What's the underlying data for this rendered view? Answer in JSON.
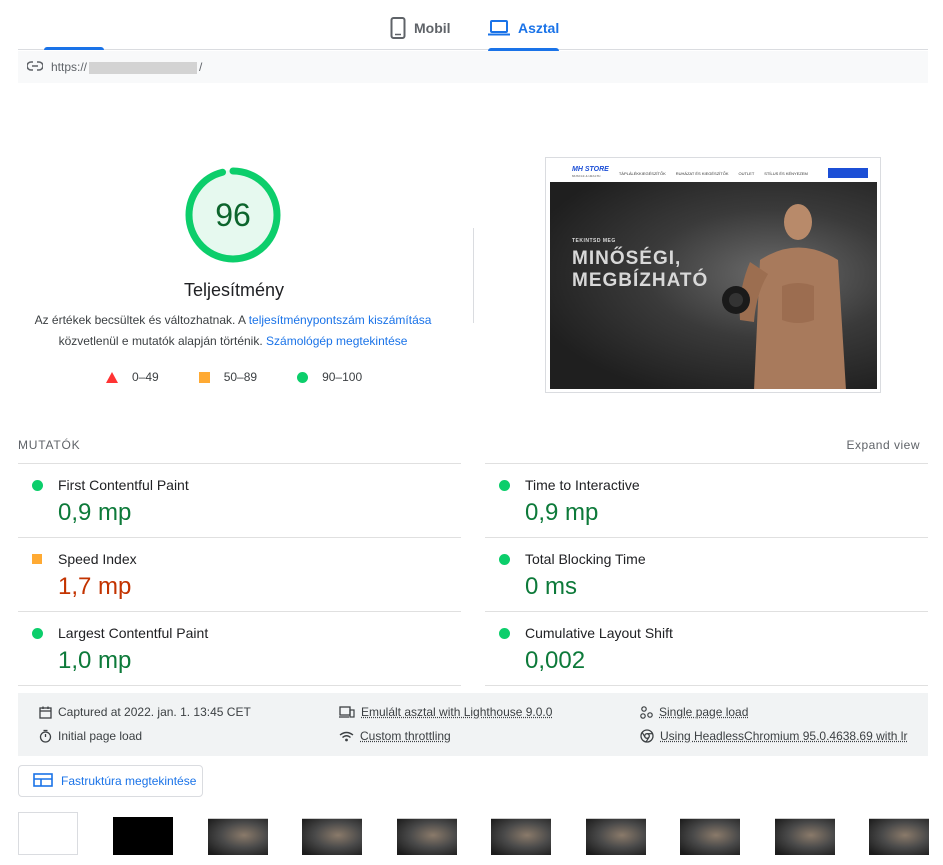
{
  "tabs": {
    "mobile_label": "Mobil",
    "desktop_label": "Asztal",
    "active": "desktop"
  },
  "url": {
    "prefix": "https://",
    "suffix": "/"
  },
  "score": {
    "value": "96",
    "fraction": 0.96,
    "title": "Teljesítmény",
    "desc_part1": "Az értékek becsültek és változhatnak. A ",
    "desc_link1": "teljesítménypontszám kiszámítása",
    "desc_part2": "közvetlenül e mutatók alapján történik. ",
    "desc_link2": "Számológép megtekintése",
    "color": "#0cce6b"
  },
  "legend": {
    "bad": "0–49",
    "average": "50–89",
    "good": "90–100"
  },
  "preview": {
    "logo": "MH STORE",
    "logo_sub": "MUSCLE & HEALTH",
    "nav1": "TÁPLÁLÉKKIEGÉSZÍTŐK",
    "nav2": "RUHÁZAT ÉS KIEGÉSZÍTŐK",
    "nav3": "OUTLET",
    "nav4": "STÍLUS ÉS KÉNYEZEM",
    "hero_small": "TEKINTSD MEG",
    "hero_line1": "MINŐSÉGI,",
    "hero_line2": "MEGBÍZHATÓ"
  },
  "metrics": {
    "heading": "MUTATÓK",
    "expand": "Expand view",
    "left": [
      {
        "label": "First Contentful Paint",
        "value": "0,9 mp",
        "rating": "good"
      },
      {
        "label": "Speed Index",
        "value": "1,7 mp",
        "rating": "average"
      },
      {
        "label": "Largest Contentful Paint",
        "value": "1,0 mp",
        "rating": "good"
      }
    ],
    "right": [
      {
        "label": "Time to Interactive",
        "value": "0,9 mp",
        "rating": "good"
      },
      {
        "label": "Total Blocking Time",
        "value": "0 ms",
        "rating": "good"
      },
      {
        "label": "Cumulative Layout Shift",
        "value": "0,002",
        "rating": "good"
      }
    ]
  },
  "info": {
    "captured": "Captured at 2022. jan. 1. 13:45 CET",
    "initial": "Initial page load",
    "emulated": "Emulált asztal with Lighthouse 9.0.0",
    "throttling": "Custom throttling",
    "single": "Single page load",
    "using": "Using HeadlessChromium 95.0.4638.69 with lr"
  },
  "tree_button": "Fastruktúra megtekintése",
  "filmstrip": [
    "blank",
    "black",
    "img",
    "img",
    "img",
    "img",
    "img",
    "img",
    "img",
    "img"
  ]
}
